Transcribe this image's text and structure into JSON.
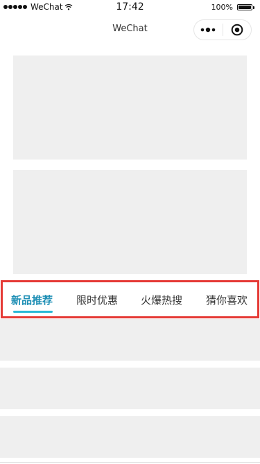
{
  "status_bar": {
    "carrier": "WeChat",
    "time": "17:42",
    "battery": "100%"
  },
  "nav_bar": {
    "title": "WeChat"
  },
  "tabs": {
    "active_index": 0,
    "items": [
      {
        "label": "新品推荐"
      },
      {
        "label": "限时优惠"
      },
      {
        "label": "火爆热搜"
      },
      {
        "label": "猜你喜欢"
      }
    ]
  },
  "colors": {
    "active_tab_text": "#1f8fb5",
    "active_tab_underline": "#2ab8d6",
    "highlight_border": "#e53935",
    "placeholder": "#efefef"
  },
  "icons": {
    "signal": "signal-dots-icon",
    "wifi": "wifi-icon",
    "battery": "battery-icon",
    "more": "more-dots-icon",
    "close": "target-circle-icon"
  }
}
